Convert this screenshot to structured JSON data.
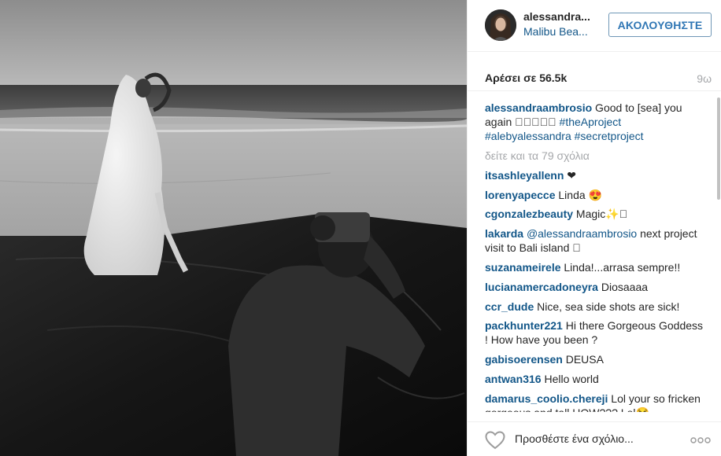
{
  "header": {
    "username": "alessandra...",
    "location": "Malibu Bea...",
    "follow_label": "ΑΚΟΛΟΥΘΗΣΤΕ"
  },
  "stats": {
    "likes": "Αρέσει σε 56.5k",
    "time": "9ω"
  },
  "caption": {
    "user": "alessandraambrosio",
    "text": " Good to [sea] you again 󾓦󾓦󾓦󾓦󾓦 ",
    "tag1": "#theAproject",
    "tag2": "#alebyalessandra",
    "tag3": "#secretproject"
  },
  "view_all": "δείτε και τα 79 σχόλια",
  "comments": [
    {
      "user": "itsashleyallenn",
      "text": " ❤"
    },
    {
      "user": "lorenyapecce",
      "text": " Linda 😍"
    },
    {
      "user": "cgonzalezbeauty",
      "text": " Magic✨󾓦"
    },
    {
      "user": "lakarda",
      "mention": "@alessandraambrosio",
      "text": " next project visit to Bali island 󾓦"
    },
    {
      "user": "suzanameirele",
      "text": " Linda!...arrasa sempre!!"
    },
    {
      "user": "lucianamercadoneyra",
      "text": " Diosaaaa"
    },
    {
      "user": "ccr_dude",
      "text": " Nice, sea side shots are sick!"
    },
    {
      "user": "packhunter221",
      "text": " Hi there Gorgeous Goddess ! How have you been ?"
    },
    {
      "user": "gabisoerensen",
      "text": " DEUSA"
    },
    {
      "user": "antwan316",
      "text": " Hello world"
    },
    {
      "user": "damarus_coolio.chereji",
      "text": " Lol your so fricken gorgeous and tall HOW??? Lol😂"
    }
  ],
  "footer": {
    "comment_placeholder": "Προσθέστε ένα σχόλιο...",
    "like_icon": "heart-outline-icon",
    "more_icon": "more-dots-icon"
  },
  "colors": {
    "link": "#125688",
    "muted": "#a5a7aa",
    "follow_border": "#6f97b6"
  }
}
